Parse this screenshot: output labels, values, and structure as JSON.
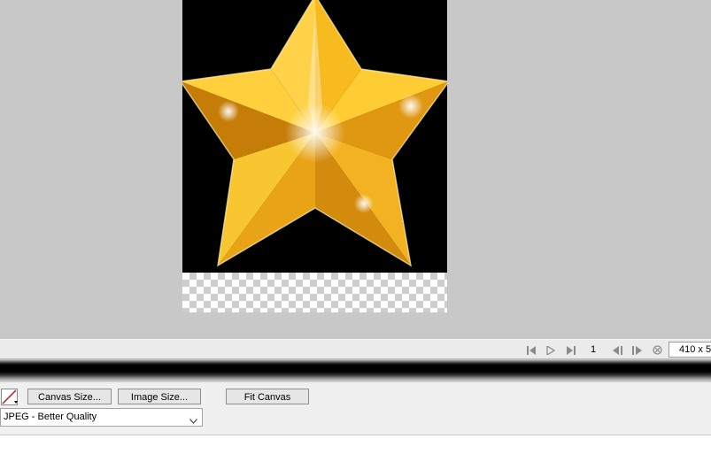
{
  "canvas": {
    "image_description": "star-image",
    "frame_number": "1",
    "image_size_readout": "410 x 5"
  },
  "toolbar": {
    "canvas_size_label": "Canvas Size...",
    "image_size_label": "Image Size...",
    "fit_canvas_label": "Fit Canvas"
  },
  "export": {
    "format_value": "JPEG - Better Quality"
  },
  "icons": {
    "first_frame": "first-frame-icon",
    "play": "play-icon",
    "last_frame": "last-frame-icon",
    "prev_frame": "previous-frame-icon",
    "next_frame": "next-frame-icon",
    "stop": "stop-icon",
    "stroke_color": "stroke-color-icon",
    "dropdown": "chevron-down-icon"
  },
  "colors": {
    "workspace_bg": "#c8c8c8",
    "star_gold": "#f2b71e",
    "star_shadow": "#c8860a"
  }
}
